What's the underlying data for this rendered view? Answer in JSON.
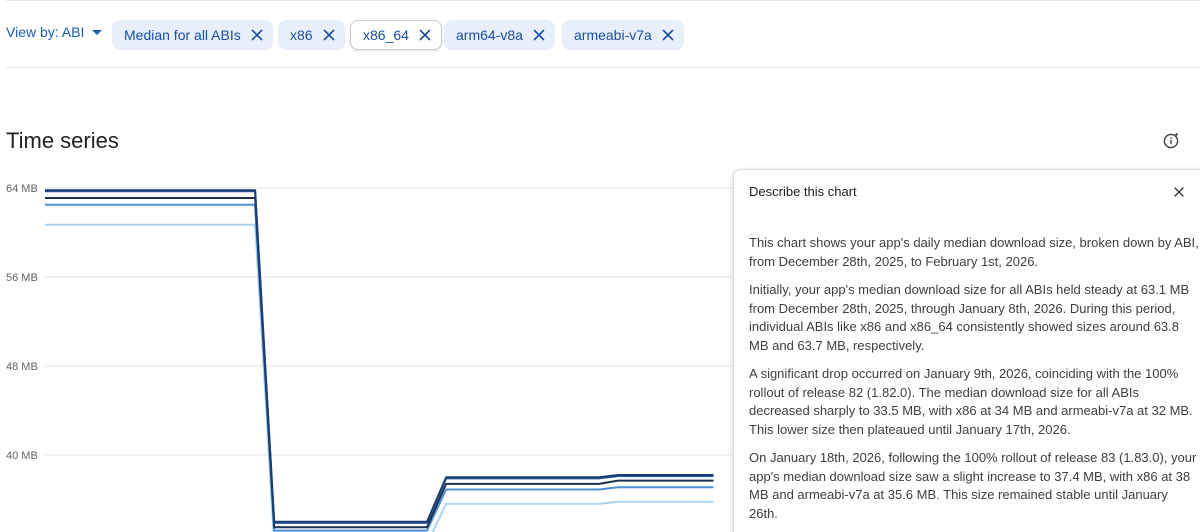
{
  "filters": {
    "view_by_label": "View by: ABI",
    "chips": [
      {
        "label": "Median for all ABIs",
        "selected": false
      },
      {
        "label": "x86",
        "selected": false
      },
      {
        "label": "x86_64",
        "selected": true
      },
      {
        "label": "arm64-v8a",
        "selected": false
      },
      {
        "label": "armeabi-v7a",
        "selected": false
      }
    ]
  },
  "section": {
    "title": "Time series"
  },
  "chart_data": {
    "type": "line",
    "title": "",
    "xlabel": "",
    "ylabel": "",
    "unit": "MB",
    "ylim": [
      34,
      65
    ],
    "y_ticks": [
      {
        "value": 64,
        "label": "64 MB"
      },
      {
        "value": 56,
        "label": "56 MB"
      },
      {
        "value": 48,
        "label": "48 MB"
      },
      {
        "value": 40,
        "label": "40 MB"
      }
    ],
    "grid": true,
    "x": [
      "2025-12-28",
      "2026-01-08",
      "2026-01-09",
      "2026-01-17",
      "2026-01-18",
      "2026-01-26",
      "2026-01-27",
      "2026-02-01"
    ],
    "series": [
      {
        "color": "#1b3e72",
        "values": [
          63.8,
          63.8,
          34.0,
          34.0,
          38.0,
          38.0,
          38.2,
          38.2
        ]
      },
      {
        "color": "#2a5a9e",
        "values": [
          63.7,
          63.7,
          33.9,
          33.9,
          37.9,
          37.9,
          38.1,
          38.1
        ]
      },
      {
        "color": "#1f2f4f",
        "values": [
          63.1,
          63.1,
          33.5,
          33.5,
          37.4,
          37.4,
          37.7,
          37.7
        ]
      },
      {
        "color": "#4f8fd8",
        "values": [
          62.5,
          62.5,
          33.2,
          33.2,
          36.9,
          36.9,
          37.1,
          37.1
        ]
      },
      {
        "color": "#a9d4f5",
        "values": [
          60.7,
          60.7,
          32.0,
          32.0,
          35.6,
          35.6,
          35.8,
          35.8
        ]
      }
    ]
  },
  "panel": {
    "title": "Describe this chart",
    "paragraphs": [
      "This chart shows your app's daily median download size, broken down by ABI, from December 28th, 2025, to February 1st, 2026.",
      "Initially, your app's median download size for all ABIs held steady at 63.1 MB from December 28th, 2025, through January 8th, 2026. During this period, individual ABIs like x86 and x86_64 consistently showed sizes around 63.8 MB and 63.7 MB, respectively.",
      "A significant drop occurred on January 9th, 2026, coinciding with the 100% rollout of release 82 (1.82.0). The median download size for all ABIs decreased sharply to 33.5 MB, with x86 at 34 MB and armeabi-v7a at 32 MB. This lower size then plateaued until January 17th, 2026.",
      "On January 18th, 2026, following the 100% rollout of release 83 (1.83.0), your app's median download size saw a slight increase to 37.4 MB, with x86 at 38 MB and armeabi-v7a at 35.6 MB. This size remained stable until January 26th."
    ]
  },
  "icons": {
    "view_by_caret": "caret-down-icon",
    "chip_remove": "close-icon",
    "info": "info-sparkle-icon",
    "panel_close": "close-icon"
  }
}
